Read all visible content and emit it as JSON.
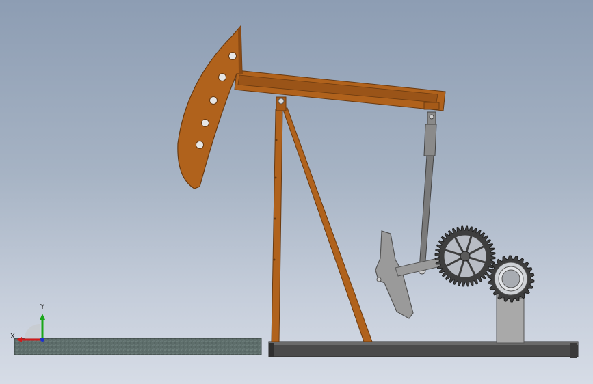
{
  "viewport": {
    "background_top": "#8d9db3",
    "background_bottom": "#d6dce6"
  },
  "model": {
    "name": "",
    "parts": [
      "walking-beam",
      "horse-head",
      "samson-post",
      "pitman-arm",
      "crank",
      "counterweight",
      "drive-gear",
      "pinion-gear",
      "motor",
      "base-skid",
      "ground-slab"
    ],
    "colors": {
      "beam": "#b0621c",
      "beam_edge": "#6a3a10",
      "steel": "#8a8a8a",
      "steel_dark": "#555555",
      "base": "#4a4a4a",
      "ground": "#5f6f6c"
    }
  },
  "triad": {
    "x_label": "X",
    "y_label": "Y",
    "x_color": "#d11a1a",
    "y_color": "#1aa61a",
    "z_color": "#1a2fd1"
  }
}
